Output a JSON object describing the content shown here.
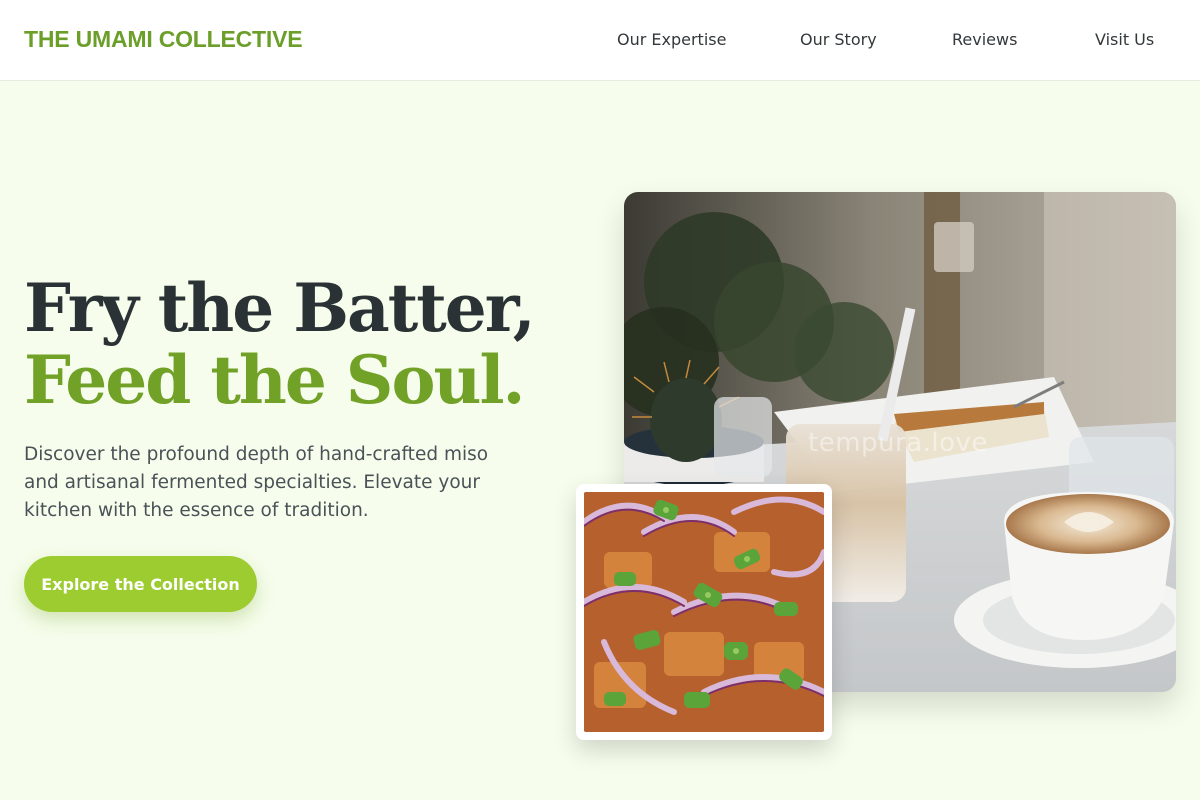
{
  "header": {
    "brand": "THE UMAMI COLLECTIVE",
    "nav": [
      {
        "label": "Our Expertise"
      },
      {
        "label": "Our Story"
      },
      {
        "label": "Reviews"
      },
      {
        "label": "Visit Us"
      }
    ]
  },
  "hero": {
    "headline_line1": "Fry the Batter,",
    "headline_line2": "Feed the Soul.",
    "description": "Discover the profound depth of hand-crafted miso and artisanal fermented specialties. Elevate your kitchen with the essence of tradition.",
    "cta_label": "Explore the Collection"
  },
  "images": {
    "main_watermark": "tempura.love",
    "main_alt": "Cafe table with iced latte, cheesecake, cappuccino and a small cactus",
    "inset_alt": "Close-up of fried dish topped with red onion and green scallions"
  },
  "colors": {
    "brand": "#6b9f2a",
    "headline_dark": "#2a3235",
    "headline_accent": "#72a128",
    "cta": "#9ccc2f",
    "background": "#f6fdec"
  }
}
